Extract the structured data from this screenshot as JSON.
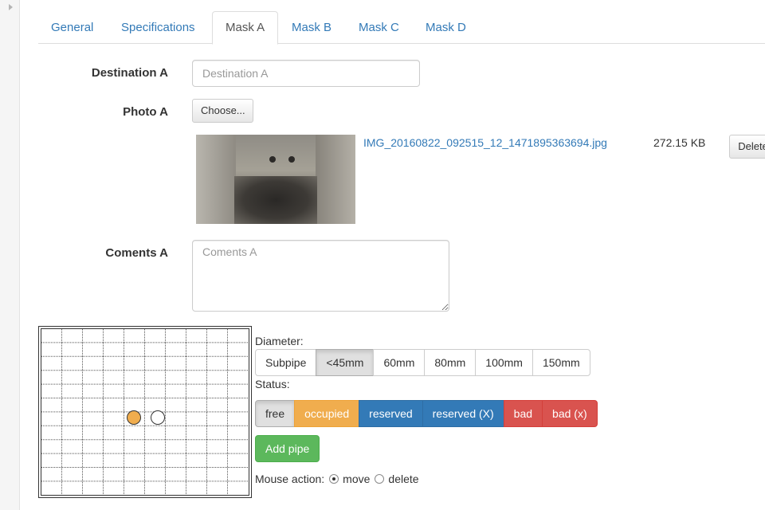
{
  "tabs": [
    {
      "label": "General",
      "active": false
    },
    {
      "label": "Specifications",
      "active": false
    },
    {
      "label": "Mask A",
      "active": true
    },
    {
      "label": "Mask B",
      "active": false
    },
    {
      "label": "Mask C",
      "active": false
    },
    {
      "label": "Mask D",
      "active": false
    }
  ],
  "form": {
    "destination": {
      "label": "Destination A",
      "value": "",
      "placeholder": "Destination A"
    },
    "photo": {
      "label": "Photo A",
      "choose_label": "Choose...",
      "file_name": "IMG_20160822_092515_12_1471895363694.jpg",
      "file_size": "272.15 KB",
      "delete_label": "Delete"
    },
    "comments": {
      "label": "Coments A",
      "value": "",
      "placeholder": "Coments A"
    }
  },
  "pipe_editor": {
    "diameter_label": "Diameter:",
    "diameter_options": [
      "Subpipe",
      "<45mm",
      "60mm",
      "80mm",
      "100mm",
      "150mm"
    ],
    "diameter_selected": "<45mm",
    "status_label": "Status:",
    "status_options": [
      "free",
      "occupied",
      "reserved",
      "reserved (X)",
      "bad",
      "bad (x)"
    ],
    "status_selected": "free",
    "add_pipe_label": "Add pipe",
    "mouse_action_label": "Mouse action:",
    "mouse_actions": [
      {
        "label": "move",
        "checked": true
      },
      {
        "label": "delete",
        "checked": false
      }
    ],
    "pipes": [
      {
        "status": "occupied",
        "color": "#f0ad4e"
      },
      {
        "status": "free",
        "color": "#ffffff"
      }
    ]
  },
  "colors": {
    "link": "#337ab7",
    "occupied": "#f0ad4e",
    "reserved": "#337ab7",
    "bad": "#d9534f",
    "success": "#5cb85c"
  }
}
